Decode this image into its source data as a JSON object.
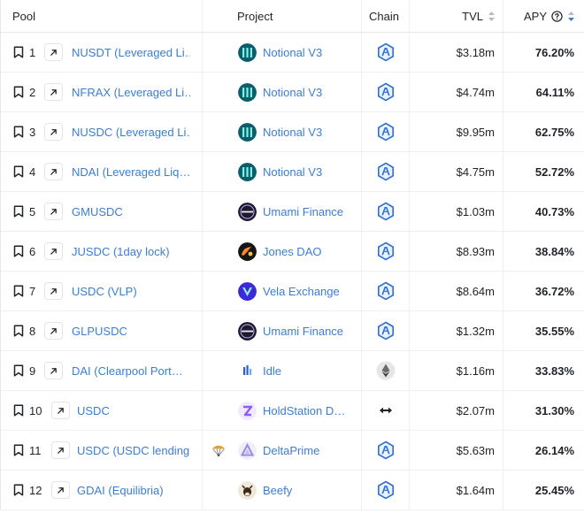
{
  "header": {
    "pool": "Pool",
    "project": "Project",
    "chain": "Chain",
    "tvl": "TVL",
    "apy": "APY"
  },
  "colors": {
    "link": "#3b7ed0",
    "arbitrum": "#2d6fd6",
    "sort_active": "#3b7ed0"
  },
  "rows": [
    {
      "rank": "1",
      "pool": "NUSDT (Leveraged Li…",
      "project": "Notional V3",
      "project_logo": "notional-logo",
      "chain": "arbitrum-icon",
      "tvl": "$3.18m",
      "apy": "76.20%"
    },
    {
      "rank": "2",
      "pool": "NFRAX (Leveraged Li…",
      "project": "Notional V3",
      "project_logo": "notional-logo",
      "chain": "arbitrum-icon",
      "tvl": "$4.74m",
      "apy": "64.11%"
    },
    {
      "rank": "3",
      "pool": "NUSDC (Leveraged Li…",
      "project": "Notional V3",
      "project_logo": "notional-logo",
      "chain": "arbitrum-icon",
      "tvl": "$9.95m",
      "apy": "62.75%"
    },
    {
      "rank": "4",
      "pool": "NDAI (Leveraged Liq…",
      "project": "Notional V3",
      "project_logo": "notional-logo",
      "chain": "arbitrum-icon",
      "tvl": "$4.75m",
      "apy": "52.72%"
    },
    {
      "rank": "5",
      "pool": "GMUSDC",
      "project": "Umami Finance",
      "project_logo": "umami-logo",
      "chain": "arbitrum-icon",
      "tvl": "$1.03m",
      "apy": "40.73%"
    },
    {
      "rank": "6",
      "pool": "JUSDC (1day lock)",
      "project": "Jones DAO",
      "project_logo": "jones-logo",
      "chain": "arbitrum-icon",
      "tvl": "$8.93m",
      "apy": "38.84%"
    },
    {
      "rank": "7",
      "pool": "USDC (VLP)",
      "project": "Vela Exchange",
      "project_logo": "vela-logo",
      "chain": "arbitrum-icon",
      "tvl": "$8.64m",
      "apy": "36.72%"
    },
    {
      "rank": "8",
      "pool": "GLPUSDC",
      "project": "Umami Finance",
      "project_logo": "umami-logo",
      "chain": "arbitrum-icon",
      "tvl": "$1.32m",
      "apy": "35.55%"
    },
    {
      "rank": "9",
      "pool": "DAI (Clearpool Port…",
      "project": "Idle",
      "project_logo": "idle-logo",
      "chain": "ethereum-icon",
      "tvl": "$1.16m",
      "apy": "33.83%"
    },
    {
      "rank": "10",
      "pool": "USDC",
      "project": "HoldStation D…",
      "project_logo": "holdstation-logo",
      "chain": "zksync-icon",
      "tvl": "$2.07m",
      "apy": "31.30%"
    },
    {
      "rank": "11",
      "pool": "USDC (USDC lending …",
      "project": "DeltaPrime",
      "project_logo": "deltaprime-logo",
      "chain": "arbitrum-icon",
      "tvl": "$5.63m",
      "apy": "26.14%",
      "side_icon": "parachute-icon"
    },
    {
      "rank": "12",
      "pool": "GDAI (Equilibria)",
      "project": "Beefy",
      "project_logo": "beefy-logo",
      "chain": "arbitrum-icon",
      "tvl": "$1.64m",
      "apy": "25.45%"
    }
  ]
}
